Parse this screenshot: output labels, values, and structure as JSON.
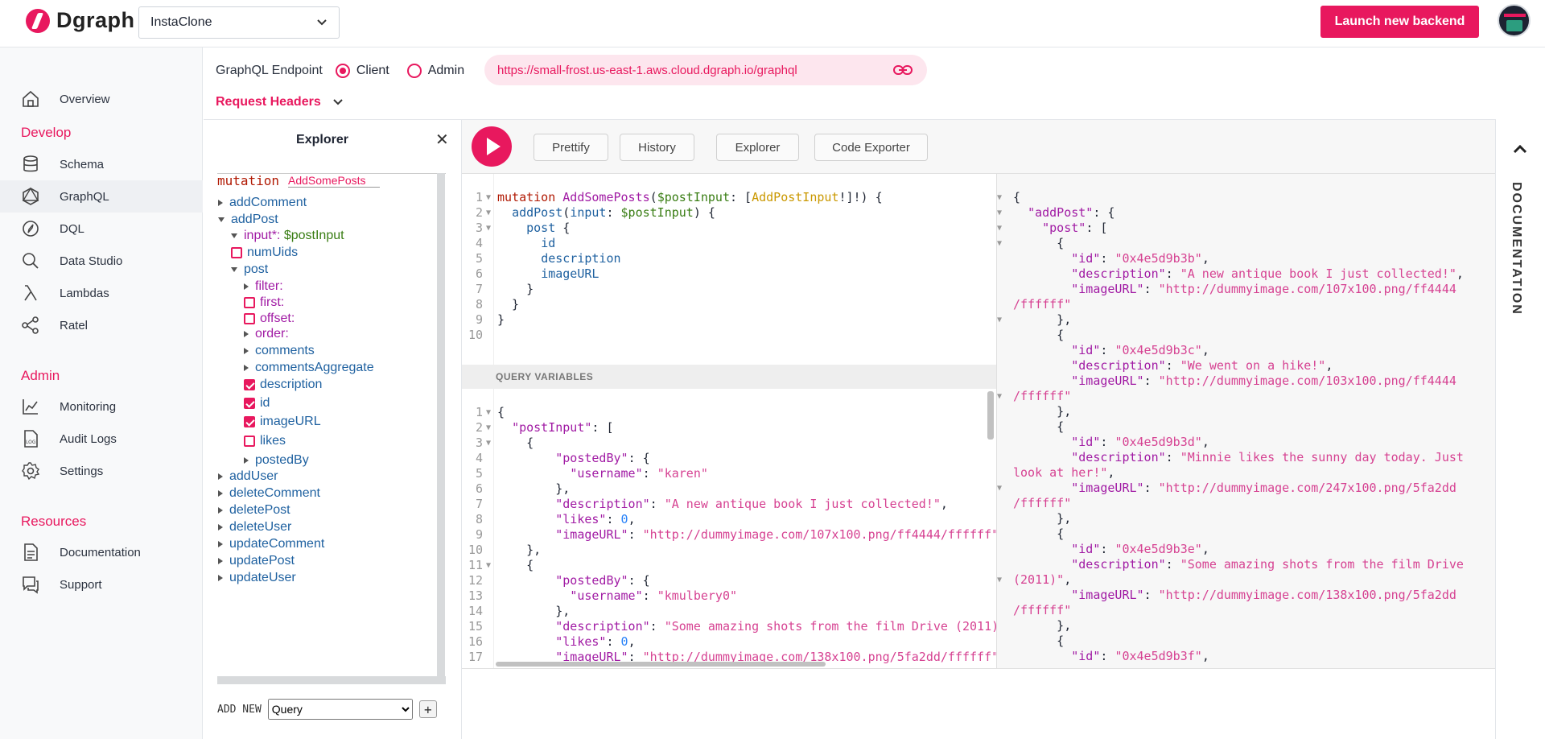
{
  "app": {
    "brand": "Dgraph",
    "backend": "InstaClone",
    "launch_label": "Launch new backend"
  },
  "sidebar": {
    "items": [
      {
        "label": "Overview",
        "icon": "home-icon"
      },
      {
        "label": "Schema",
        "icon": "database-icon"
      },
      {
        "label": "GraphQL",
        "icon": "graphql-icon"
      },
      {
        "label": "DQL",
        "icon": "compass-icon"
      },
      {
        "label": "Data Studio",
        "icon": "search-icon"
      },
      {
        "label": "Lambdas",
        "icon": "lambda-icon"
      },
      {
        "label": "Ratel",
        "icon": "share-icon"
      },
      {
        "label": "Monitoring",
        "icon": "chart-icon"
      },
      {
        "label": "Audit Logs",
        "icon": "log-icon"
      },
      {
        "label": "Settings",
        "icon": "gear-icon"
      },
      {
        "label": "Documentation",
        "icon": "document-icon"
      },
      {
        "label": "Support",
        "icon": "chat-icon"
      }
    ],
    "sections": {
      "develop": "Develop",
      "admin": "Admin",
      "resources": "Resources"
    }
  },
  "endpoint": {
    "label": "GraphQL Endpoint",
    "client": "Client",
    "admin": "Admin",
    "url": "https://small-frost.us-east-1.aws.cloud.dgraph.io/graphql",
    "request_headers": "Request Headers"
  },
  "explorer": {
    "title": "Explorer",
    "op_type": "mutation",
    "op_name": "AddSomePosts",
    "tree": [
      {
        "label": "addComment"
      },
      {
        "label": "addPost"
      },
      {
        "label": "input*:",
        "value": "$postInput"
      },
      {
        "label": "numUids"
      },
      {
        "label": "post"
      },
      {
        "label": "filter:"
      },
      {
        "label": "first:"
      },
      {
        "label": "offset:"
      },
      {
        "label": "order:"
      },
      {
        "label": "comments"
      },
      {
        "label": "commentsAggregate"
      },
      {
        "label": "description"
      },
      {
        "label": "id"
      },
      {
        "label": "imageURL"
      },
      {
        "label": "likes"
      },
      {
        "label": "postedBy"
      },
      {
        "label": "addUser"
      },
      {
        "label": "deleteComment"
      },
      {
        "label": "deletePost"
      },
      {
        "label": "deleteUser"
      },
      {
        "label": "updateComment"
      },
      {
        "label": "updatePost"
      },
      {
        "label": "updateUser"
      }
    ],
    "add_new_label": "ADD NEW",
    "add_new_option": "Query"
  },
  "toolbar": {
    "prettify": "Prettify",
    "history": "History",
    "explorer": "Explorer",
    "code_exporter": "Code Exporter"
  },
  "query_variables_label": "QUERY VARIABLES",
  "documentation_label": "DOCUMENTATION"
}
